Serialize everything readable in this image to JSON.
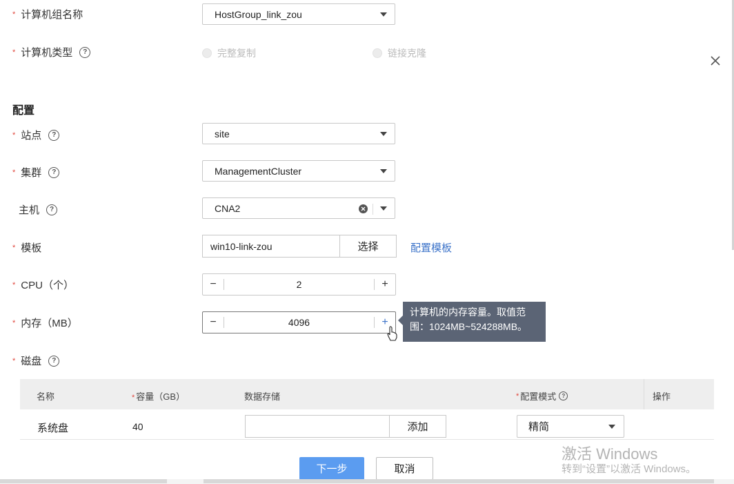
{
  "form": {
    "group_name": {
      "label": "计算机组名称",
      "value": "HostGroup_link_zou"
    },
    "vm_type": {
      "label": "计算机类型",
      "options": [
        "完整复制",
        "链接克隆"
      ]
    },
    "config_title": "配置",
    "site": {
      "label": "站点",
      "value": "site"
    },
    "cluster": {
      "label": "集群",
      "value": "ManagementCluster"
    },
    "host": {
      "label": "主机",
      "value": "CNA2"
    },
    "template": {
      "label": "模板",
      "value": "win10-link-zou",
      "select_label": "选择",
      "config_link": "配置模板"
    },
    "cpu": {
      "label": "CPU（个）",
      "value": "2"
    },
    "memory": {
      "label": "内存（MB）",
      "value": "4096"
    },
    "disk": {
      "label": "磁盘"
    }
  },
  "tooltip": {
    "text": "计算机的内存容量。取值范围：1024MB~524288MB。"
  },
  "disk_table": {
    "headers": {
      "name": "名称",
      "capacity": "容量（GB）",
      "datastore": "数据存储",
      "mode": "配置模式",
      "ops": "操作"
    },
    "rows": [
      {
        "name": "系统盘",
        "capacity": "40",
        "add_label": "添加",
        "mode": "精简"
      }
    ]
  },
  "footer": {
    "next_label": "下一步",
    "cancel_label": "取消"
  },
  "watermark": {
    "line1": "激活 Windows",
    "line2": "转到“设置”以激活 Windows。"
  },
  "icons": {
    "close": "close-icon",
    "help": "help-icon",
    "clear": "clear-icon",
    "caret": "chevron-down-icon",
    "cursor": "hand-cursor-icon"
  },
  "colors": {
    "primary": "#5b9cf0",
    "required": "#e0443a",
    "tooltip_bg": "#5b6475",
    "link": "#3c73c9"
  }
}
